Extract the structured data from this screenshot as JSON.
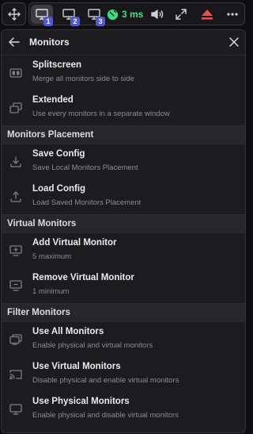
{
  "toolbar": {
    "move_icon": "move-arrows-icon",
    "monitors": [
      {
        "badge": "1",
        "active": true
      },
      {
        "badge": "2",
        "active": false
      },
      {
        "badge": "3",
        "active": false
      }
    ],
    "latency": "3 ms",
    "latency_color": "#3ddc84",
    "accent_color": "#4f5bd5",
    "disconnect_color": "#e5534b",
    "icons": [
      "globe-icon",
      "volume-icon",
      "expand-icon",
      "eject-icon",
      "more-icon"
    ]
  },
  "panel": {
    "title": "Monitors",
    "sections": [
      {
        "header": "",
        "items": [
          {
            "title": "Splitscreen",
            "desc": "Merge all monitors side to side"
          },
          {
            "title": "Extended",
            "desc": "Use every monitors in a separate window"
          }
        ]
      },
      {
        "header": "Monitors Placement",
        "items": [
          {
            "title": "Save Config",
            "desc": "Save Local Monitors Placement"
          },
          {
            "title": "Load Config",
            "desc": "Load Saved Monitors Placement"
          }
        ]
      },
      {
        "header": "Virtual Monitors",
        "items": [
          {
            "title": "Add Virtual Monitor",
            "desc": "5 maximum"
          },
          {
            "title": "Remove Virtual Monitor",
            "desc": "1 minimum"
          }
        ]
      },
      {
        "header": "Filter Monitors",
        "items": [
          {
            "title": "Use All Monitors",
            "desc": "Enable physical and virtual monitors"
          },
          {
            "title": "Use Virtual Monitors",
            "desc": "Disable physical and enable virtual monitors"
          },
          {
            "title": "Use Physical Monitors",
            "desc": "Enable physical and disable virtual monitors"
          }
        ]
      }
    ]
  }
}
